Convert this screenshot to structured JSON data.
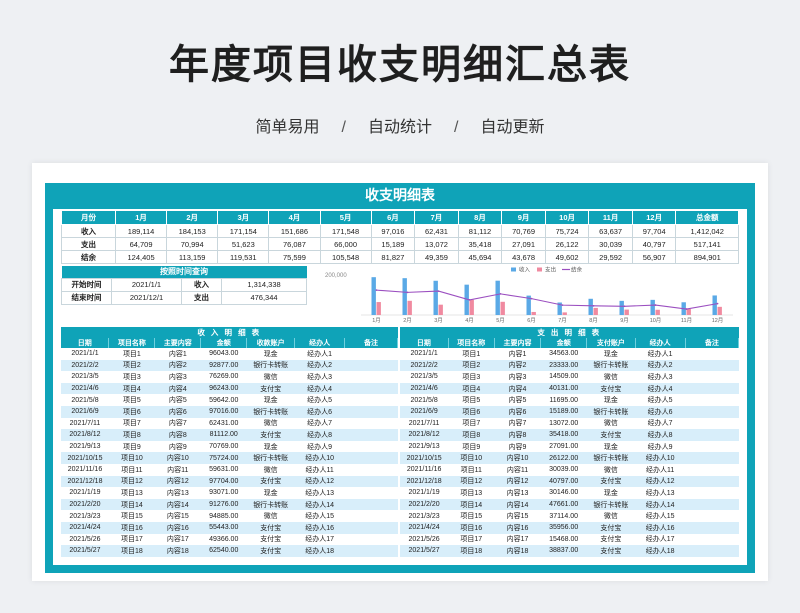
{
  "header": {
    "title": "年度项目收支明细汇总表",
    "subtitle": [
      "简单易用",
      "自动统计",
      "自动更新"
    ],
    "separator": "/"
  },
  "sheet": {
    "title": "收支明细表",
    "summary": {
      "month_header": "月份",
      "months": [
        "1月",
        "2月",
        "3月",
        "4月",
        "5月",
        "6月",
        "7月",
        "8月",
        "9月",
        "10月",
        "11月",
        "12月"
      ],
      "total_header": "总金额",
      "rows": [
        {
          "label": "收入",
          "values": [
            "189,114",
            "184,153",
            "171,154",
            "151,686",
            "171,548",
            "97,016",
            "62,431",
            "81,112",
            "70,769",
            "75,724",
            "63,637",
            "97,704"
          ],
          "total": "1,412,042"
        },
        {
          "label": "支出",
          "values": [
            "64,709",
            "70,994",
            "51,623",
            "76,087",
            "66,000",
            "15,189",
            "13,072",
            "35,418",
            "27,091",
            "26,122",
            "30,039",
            "40,797"
          ],
          "total": "517,141"
        },
        {
          "label": "结余",
          "values": [
            "124,405",
            "113,159",
            "119,531",
            "75,599",
            "105,548",
            "81,827",
            "49,359",
            "45,694",
            "43,678",
            "49,602",
            "29,592",
            "56,907"
          ],
          "total": "894,901"
        }
      ]
    },
    "query": {
      "title": "按照时间查询",
      "start_label": "开始时间",
      "start_value": "2021/1/1",
      "end_label": "结束时间",
      "end_value": "2021/12/1",
      "income_label": "收入",
      "income_value": "1,314,338",
      "expense_label": "支出",
      "expense_value": "476,344"
    },
    "income_detail": {
      "title": "收 入 明 细 表",
      "columns": [
        "日期",
        "项目名称",
        "主要内容",
        "金额",
        "收款账户",
        "经办人",
        "备注"
      ],
      "rows": [
        [
          "2021/1/1",
          "项目1",
          "内容1",
          "96043.00",
          "现金",
          "经办人1",
          ""
        ],
        [
          "2021/2/2",
          "项目2",
          "内容2",
          "92877.00",
          "银行卡转账",
          "经办人2",
          ""
        ],
        [
          "2021/3/5",
          "项目3",
          "内容3",
          "76269.00",
          "微信",
          "经办人3",
          ""
        ],
        [
          "2021/4/6",
          "项目4",
          "内容4",
          "96243.00",
          "支付宝",
          "经办人4",
          ""
        ],
        [
          "2021/5/8",
          "项目5",
          "内容5",
          "59642.00",
          "现金",
          "经办人5",
          ""
        ],
        [
          "2021/6/9",
          "项目6",
          "内容6",
          "97016.00",
          "银行卡转账",
          "经办人6",
          ""
        ],
        [
          "2021/7/11",
          "项目7",
          "内容7",
          "62431.00",
          "微信",
          "经办人7",
          ""
        ],
        [
          "2021/8/12",
          "项目8",
          "内容8",
          "81112.00",
          "支付宝",
          "经办人8",
          ""
        ],
        [
          "2021/9/13",
          "项目9",
          "内容9",
          "70769.00",
          "现金",
          "经办人9",
          ""
        ],
        [
          "2021/10/15",
          "项目10",
          "内容10",
          "75724.00",
          "银行卡转账",
          "经办人10",
          ""
        ],
        [
          "2021/11/16",
          "项目11",
          "内容11",
          "59631.00",
          "微信",
          "经办人11",
          ""
        ],
        [
          "2021/12/18",
          "项目12",
          "内容12",
          "97704.00",
          "支付宝",
          "经办人12",
          ""
        ],
        [
          "2021/1/19",
          "项目13",
          "内容13",
          "93071.00",
          "现金",
          "经办人13",
          ""
        ],
        [
          "2021/2/20",
          "项目14",
          "内容14",
          "91276.00",
          "银行卡转账",
          "经办人14",
          ""
        ],
        [
          "2021/3/23",
          "项目15",
          "内容15",
          "94885.00",
          "微信",
          "经办人15",
          ""
        ],
        [
          "2021/4/24",
          "项目16",
          "内容16",
          "55443.00",
          "支付宝",
          "经办人16",
          ""
        ],
        [
          "2021/5/26",
          "项目17",
          "内容17",
          "49366.00",
          "支付宝",
          "经办人17",
          ""
        ],
        [
          "2021/5/27",
          "项目18",
          "内容18",
          "62540.00",
          "支付宝",
          "经办人18",
          ""
        ]
      ]
    },
    "expense_detail": {
      "title": "支 出 明 细 表",
      "columns": [
        "日期",
        "项目名称",
        "主要内容",
        "金额",
        "支付账户",
        "经办人",
        "备注"
      ],
      "rows": [
        [
          "2021/1/1",
          "项目1",
          "内容1",
          "34563.00",
          "现金",
          "经办人1",
          ""
        ],
        [
          "2021/2/2",
          "项目2",
          "内容2",
          "23333.00",
          "银行卡转账",
          "经办人2",
          ""
        ],
        [
          "2021/3/5",
          "项目3",
          "内容3",
          "14509.00",
          "微信",
          "经办人3",
          ""
        ],
        [
          "2021/4/6",
          "项目4",
          "内容4",
          "40131.00",
          "支付宝",
          "经办人4",
          ""
        ],
        [
          "2021/5/8",
          "项目5",
          "内容5",
          "11695.00",
          "现金",
          "经办人5",
          ""
        ],
        [
          "2021/6/9",
          "项目6",
          "内容6",
          "15189.00",
          "银行卡转账",
          "经办人6",
          ""
        ],
        [
          "2021/7/11",
          "项目7",
          "内容7",
          "13072.00",
          "微信",
          "经办人7",
          ""
        ],
        [
          "2021/8/12",
          "项目8",
          "内容8",
          "35418.00",
          "支付宝",
          "经办人8",
          ""
        ],
        [
          "2021/9/13",
          "项目9",
          "内容9",
          "27091.00",
          "现金",
          "经办人9",
          ""
        ],
        [
          "2021/10/15",
          "项目10",
          "内容10",
          "26122.00",
          "银行卡转账",
          "经办人10",
          ""
        ],
        [
          "2021/11/16",
          "项目11",
          "内容11",
          "30039.00",
          "微信",
          "经办人11",
          ""
        ],
        [
          "2021/12/18",
          "项目12",
          "内容12",
          "40797.00",
          "支付宝",
          "经办人12",
          ""
        ],
        [
          "2021/1/19",
          "项目13",
          "内容13",
          "30146.00",
          "现金",
          "经办人13",
          ""
        ],
        [
          "2021/2/20",
          "项目14",
          "内容14",
          "47661.00",
          "银行卡转账",
          "经办人14",
          ""
        ],
        [
          "2021/3/23",
          "项目15",
          "内容15",
          "37114.00",
          "微信",
          "经办人15",
          ""
        ],
        [
          "2021/4/24",
          "项目16",
          "内容16",
          "35956.00",
          "支付宝",
          "经办人16",
          ""
        ],
        [
          "2021/5/26",
          "项目17",
          "内容17",
          "15468.00",
          "支付宝",
          "经办人17",
          ""
        ],
        [
          "2021/5/27",
          "项目18",
          "内容18",
          "38837.00",
          "支付宝",
          "经办人18",
          ""
        ]
      ]
    }
  },
  "chart_data": {
    "type": "bar",
    "categories": [
      "1月",
      "2月",
      "3月",
      "4月",
      "5月",
      "6月",
      "7月",
      "8月",
      "9月",
      "10月",
      "11月",
      "12月"
    ],
    "series": [
      {
        "name": "收入",
        "type": "bar",
        "color": "#5aa9e6",
        "values": [
          189114,
          184153,
          171154,
          151686,
          171548,
          97016,
          62431,
          81112,
          70769,
          75724,
          63637,
          97704
        ]
      },
      {
        "name": "支出",
        "type": "bar",
        "color": "#f08aa0",
        "values": [
          64709,
          70994,
          51623,
          76087,
          66000,
          15189,
          13072,
          35418,
          27091,
          26122,
          30039,
          40797
        ]
      },
      {
        "name": "结余",
        "type": "line",
        "color": "#9b4fc0",
        "values": [
          124405,
          113159,
          119531,
          75599,
          105548,
          81827,
          49359,
          45694,
          43678,
          49602,
          29592,
          56907
        ]
      }
    ],
    "ylim": [
      0,
      200000
    ],
    "yticks": [
      "200,000"
    ],
    "legend": "top-center"
  },
  "colors": {
    "accent": "#0fa3b8",
    "stripe": "#d8eefa"
  }
}
